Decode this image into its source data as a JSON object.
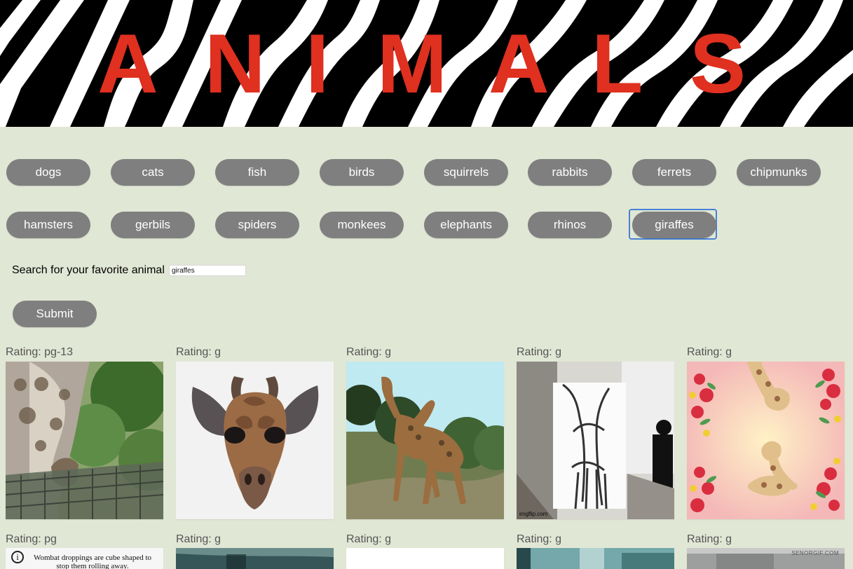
{
  "app": {
    "title": "ANIMALS",
    "title_letters": [
      "A",
      "N",
      "I",
      "M",
      "A",
      "L",
      "S"
    ]
  },
  "buttons": [
    {
      "label": "dogs"
    },
    {
      "label": "cats"
    },
    {
      "label": "fish"
    },
    {
      "label": "birds"
    },
    {
      "label": "squirrels"
    },
    {
      "label": "rabbits"
    },
    {
      "label": "ferrets"
    },
    {
      "label": "chipmunks"
    },
    {
      "label": "hamsters"
    },
    {
      "label": "gerbils"
    },
    {
      "label": "spiders"
    },
    {
      "label": "monkees"
    },
    {
      "label": "elephants"
    },
    {
      "label": "rhinos"
    },
    {
      "label": "giraffes"
    }
  ],
  "search": {
    "label": "Search for your favorite animal",
    "value": "giraffes",
    "submit": "Submit"
  },
  "results": {
    "row1": [
      {
        "rating": "Rating: pg-13"
      },
      {
        "rating": "Rating: g"
      },
      {
        "rating": "Rating: g"
      },
      {
        "rating": "Rating: g",
        "watermark": "imgflip.com"
      },
      {
        "rating": "Rating: g"
      }
    ],
    "row2": [
      {
        "rating": "Rating: pg",
        "caption": "Wombat droppings are cube shaped to stop them rolling away."
      },
      {
        "rating": "Rating: g"
      },
      {
        "rating": "Rating: g"
      },
      {
        "rating": "Rating: g"
      },
      {
        "rating": "Rating: g",
        "watermark": "SENORGIF.COM"
      }
    ]
  },
  "colors": {
    "page_background": "#e1e7d5",
    "button_background": "#7f7f7f",
    "title_red": "#df3020",
    "focus_blue": "#4a81d4"
  }
}
